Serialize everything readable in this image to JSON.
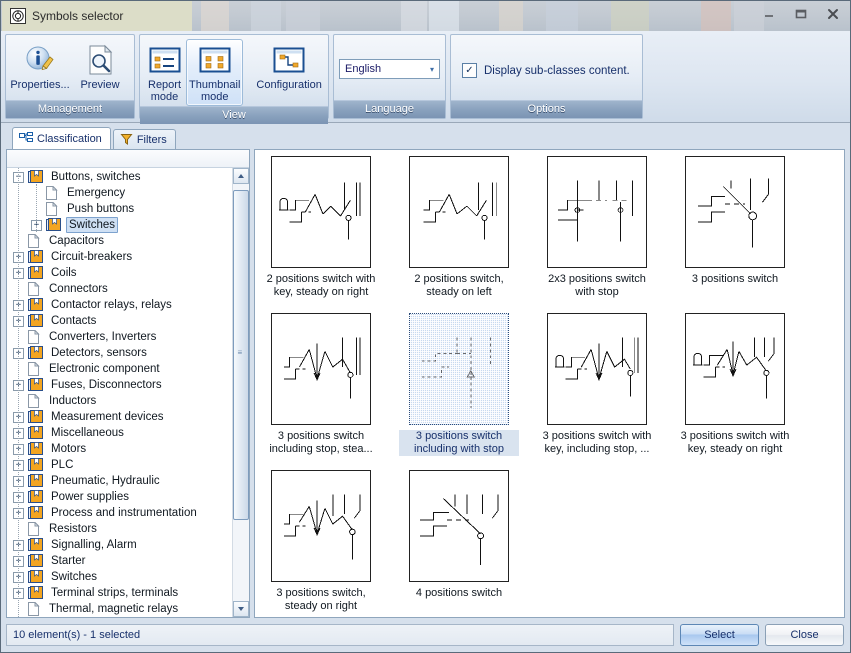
{
  "window": {
    "title": "Symbols selector",
    "icon": "app-symbols-icon",
    "minimize_label": "–",
    "maximize_label": "❐",
    "close_label": "✕"
  },
  "ribbon": {
    "groups": [
      {
        "caption": "Management",
        "buttons": [
          {
            "label": "Properties...",
            "icon": "properties-info-pencil-icon",
            "selected": false
          },
          {
            "label": "Preview",
            "icon": "preview-page-magnifier-icon",
            "selected": false
          }
        ]
      },
      {
        "caption": "View",
        "buttons": [
          {
            "label": "Report\nmode",
            "icon": "report-mode-icon",
            "selected": false
          },
          {
            "label": "Thumbnail\nmode",
            "icon": "thumbnail-mode-icon",
            "selected": true
          },
          {
            "label": "Configuration",
            "icon": "configuration-icon",
            "selected": false
          }
        ]
      },
      {
        "caption": "Language",
        "combo": {
          "value": "English",
          "arrow": "▾"
        }
      },
      {
        "caption": "Options",
        "checkbox": {
          "label": "Display sub-classes content.",
          "checked": true,
          "mark": "✓"
        }
      }
    ]
  },
  "left_panel": {
    "tabs": [
      {
        "label": "Classification",
        "icon": "classification-tree-icon",
        "active": true
      },
      {
        "label": "Filters",
        "icon": "filter-funnel-icon",
        "active": false
      }
    ],
    "tree": [
      {
        "label": "Buttons, switches",
        "depth": 0,
        "twist": "−",
        "icon": "book-folder-icon",
        "selected": false
      },
      {
        "label": "Emergency",
        "depth": 1,
        "twist": "",
        "icon": "page-icon",
        "selected": false
      },
      {
        "label": "Push buttons",
        "depth": 1,
        "twist": "",
        "icon": "page-icon",
        "selected": false
      },
      {
        "label": "Switches",
        "depth": 1,
        "twist": "+",
        "icon": "book-folder-icon",
        "selected": true
      },
      {
        "label": "Capacitors",
        "depth": 0,
        "twist": "",
        "icon": "page-icon",
        "selected": false
      },
      {
        "label": "Circuit-breakers",
        "depth": 0,
        "twist": "+",
        "icon": "book-folder-icon",
        "selected": false
      },
      {
        "label": "Coils",
        "depth": 0,
        "twist": "+",
        "icon": "book-folder-icon",
        "selected": false
      },
      {
        "label": "Connectors",
        "depth": 0,
        "twist": "",
        "icon": "page-icon",
        "selected": false
      },
      {
        "label": "Contactor relays, relays",
        "depth": 0,
        "twist": "+",
        "icon": "book-folder-icon",
        "selected": false
      },
      {
        "label": "Contacts",
        "depth": 0,
        "twist": "+",
        "icon": "book-folder-icon",
        "selected": false
      },
      {
        "label": "Converters, Inverters",
        "depth": 0,
        "twist": "",
        "icon": "page-icon",
        "selected": false
      },
      {
        "label": "Detectors, sensors",
        "depth": 0,
        "twist": "+",
        "icon": "book-folder-icon",
        "selected": false
      },
      {
        "label": "Electronic component",
        "depth": 0,
        "twist": "",
        "icon": "page-icon",
        "selected": false
      },
      {
        "label": "Fuses, Disconnectors",
        "depth": 0,
        "twist": "+",
        "icon": "book-folder-icon",
        "selected": false
      },
      {
        "label": "Inductors",
        "depth": 0,
        "twist": "",
        "icon": "page-icon",
        "selected": false
      },
      {
        "label": "Measurement devices",
        "depth": 0,
        "twist": "+",
        "icon": "book-folder-icon",
        "selected": false
      },
      {
        "label": "Miscellaneous",
        "depth": 0,
        "twist": "+",
        "icon": "book-folder-icon",
        "selected": false
      },
      {
        "label": "Motors",
        "depth": 0,
        "twist": "+",
        "icon": "book-folder-icon",
        "selected": false
      },
      {
        "label": "PLC",
        "depth": 0,
        "twist": "+",
        "icon": "book-folder-icon",
        "selected": false
      },
      {
        "label": "Pneumatic, Hydraulic",
        "depth": 0,
        "twist": "+",
        "icon": "book-folder-icon",
        "selected": false
      },
      {
        "label": "Power supplies",
        "depth": 0,
        "twist": "+",
        "icon": "book-folder-icon",
        "selected": false
      },
      {
        "label": "Process and instrumentation",
        "depth": 0,
        "twist": "+",
        "icon": "book-folder-icon",
        "selected": false
      },
      {
        "label": "Resistors",
        "depth": 0,
        "twist": "",
        "icon": "page-icon",
        "selected": false
      },
      {
        "label": "Signalling, Alarm",
        "depth": 0,
        "twist": "+",
        "icon": "book-folder-icon",
        "selected": false
      },
      {
        "label": "Starter",
        "depth": 0,
        "twist": "+",
        "icon": "book-folder-icon",
        "selected": false
      },
      {
        "label": "Switches",
        "depth": 0,
        "twist": "+",
        "icon": "book-folder-icon",
        "selected": false
      },
      {
        "label": "Terminal strips, terminals",
        "depth": 0,
        "twist": "+",
        "icon": "book-folder-icon",
        "selected": false
      },
      {
        "label": "Thermal, magnetic relays",
        "depth": 0,
        "twist": "",
        "icon": "page-icon",
        "selected": false
      }
    ],
    "scrollbar": {
      "up": "▲",
      "down": "▼",
      "grip": "≡"
    }
  },
  "thumbnails": [
    {
      "label": "2 positions switch with key, steady on right",
      "symbol": "sw2-key-steady-right",
      "selected": false
    },
    {
      "label": "2 positions switch, steady on left",
      "symbol": "sw2-steady-left",
      "selected": false
    },
    {
      "label": "2x3 positions switch with stop",
      "symbol": "sw2x3-stop",
      "selected": false
    },
    {
      "label": "3 positions switch",
      "symbol": "sw3-plain",
      "selected": false
    },
    {
      "label": "3 positions switch including stop, stea...",
      "symbol": "sw3-stop-steady",
      "selected": false
    },
    {
      "label": "3 positions switch including with stop",
      "symbol": "sw3-with-stop",
      "selected": true
    },
    {
      "label": "3 positions switch with key, including stop, ...",
      "symbol": "sw3-key-stop",
      "selected": false
    },
    {
      "label": "3 positions switch with key, steady on right",
      "symbol": "sw3-key-steady-right",
      "selected": false
    },
    {
      "label": "3 positions switch, steady on right",
      "symbol": "sw3-steady-right",
      "selected": false
    },
    {
      "label": "4 positions switch",
      "symbol": "sw4-plain",
      "selected": false
    }
  ],
  "footer": {
    "status": "10 element(s) - 1 selected",
    "select_label": "Select",
    "close_label": "Close"
  }
}
